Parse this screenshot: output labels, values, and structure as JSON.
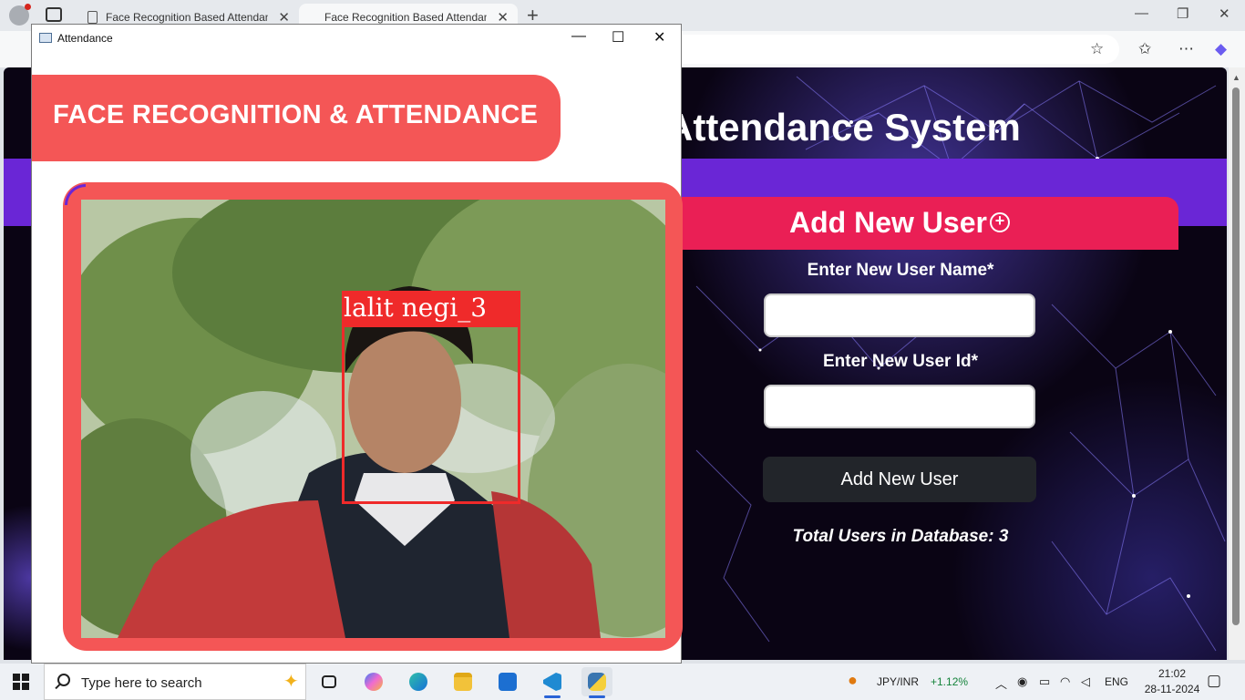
{
  "browser": {
    "tabs": [
      {
        "title": "Face Recognition Based Attendan"
      },
      {
        "title": "Face Recognition Based Attendan"
      }
    ]
  },
  "webpage": {
    "banner_title": "Attendance System",
    "add_user": {
      "heading": "Add New User",
      "name_label": "Enter New User Name*",
      "name_value": "",
      "id_label": "Enter New User Id*",
      "id_value": "",
      "button_label": "Add New User",
      "total_users": "Total Users in Database: 3"
    },
    "colors": {
      "banner": "#6a26d6",
      "card_header": "#ea1f55",
      "button": "#22252a"
    }
  },
  "attendance_window": {
    "title": "Attendance",
    "header": "FACE RECOGNITION & ATTENDANCE",
    "detected_label": "lalit negi_3",
    "colors": {
      "frame": "#f45656",
      "detection_box": "#ef2a2a"
    }
  },
  "taskbar": {
    "search_placeholder": "Type here to search",
    "ticker_symbol": "JPY/INR",
    "ticker_change": "+1.12%",
    "language": "ENG",
    "time": "21:02",
    "date": "28-11-2024"
  }
}
